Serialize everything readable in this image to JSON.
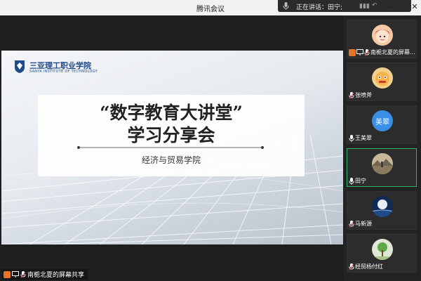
{
  "window": {
    "title": "腾讯会议"
  },
  "speaking": {
    "text": "正在讲话：田宁;"
  },
  "controls": {
    "minimize": "—",
    "maximize": "☐",
    "close": "✕"
  },
  "slide": {
    "school_cn": "三亚理工职业学院",
    "school_en": "SANYA INSTITUTE OF TECHNOLOGY",
    "title_line1": "“数字教育大讲堂”",
    "title_line2": "学习分享会",
    "subtitle": "经济与贸易学院"
  },
  "share": {
    "label": "南栀北夏的屏幕共享"
  },
  "participants": [
    {
      "name": "南栀北夏的屏幕...",
      "avatar": "cartoon-girl",
      "sharing": true
    },
    {
      "name": "张喷斧",
      "avatar": "cartoon-face",
      "sharing": false
    },
    {
      "name": "王美翠",
      "avatar": "text",
      "avatar_text": "美翠",
      "avatar_color": "#3a8ee6",
      "sharing": false
    },
    {
      "name": "田宁",
      "avatar": "photo-landscape",
      "sharing": false,
      "active": true
    },
    {
      "name": "马新源",
      "avatar": "photo-moon",
      "sharing": false
    },
    {
      "name": "经贸杨付红",
      "avatar": "photo-plant",
      "sharing": false
    }
  ],
  "colors": {
    "active_border": "#2fb56a",
    "brand_blue": "#1f4a8a",
    "share_orange": "#e8742a"
  }
}
